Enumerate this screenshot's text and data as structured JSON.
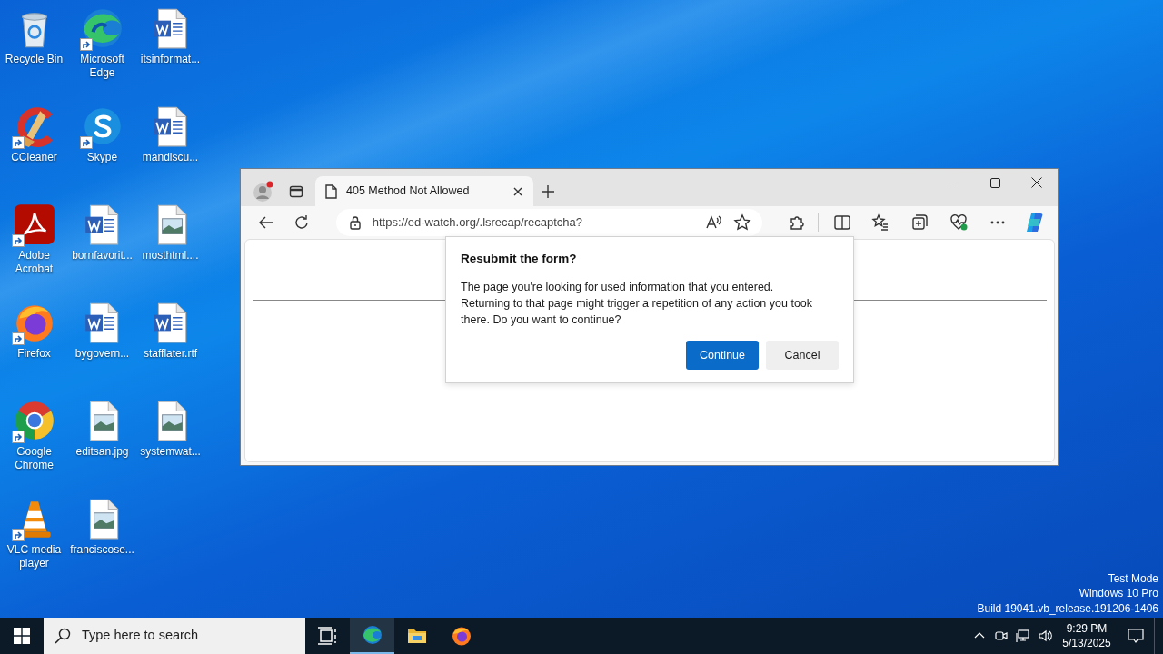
{
  "desktop_icons": [
    {
      "label": "Recycle Bin",
      "kind": "recycle",
      "shortcut": false
    },
    {
      "label": "CCleaner",
      "kind": "ccleaner",
      "shortcut": true
    },
    {
      "label": "Adobe Acrobat",
      "kind": "acrobat",
      "shortcut": true
    },
    {
      "label": "Firefox",
      "kind": "firefox",
      "shortcut": true
    },
    {
      "label": "Google Chrome",
      "kind": "chrome",
      "shortcut": true
    },
    {
      "label": "VLC media player",
      "kind": "vlc",
      "shortcut": true
    },
    {
      "label": "Microsoft Edge",
      "kind": "edge",
      "shortcut": true
    },
    {
      "label": "Skype",
      "kind": "skype",
      "shortcut": true
    },
    {
      "label": "bornfavorit...",
      "kind": "word",
      "shortcut": false
    },
    {
      "label": "bygovern...",
      "kind": "word",
      "shortcut": false
    },
    {
      "label": "editsan.jpg",
      "kind": "image",
      "shortcut": false
    },
    {
      "label": "franciscose...",
      "kind": "image",
      "shortcut": false
    },
    {
      "label": "itsinformat...",
      "kind": "word",
      "shortcut": false
    },
    {
      "label": "mandiscu...",
      "kind": "word",
      "shortcut": false
    },
    {
      "label": "mosthtml....",
      "kind": "image",
      "shortcut": false
    },
    {
      "label": "stafflater.rtf",
      "kind": "word",
      "shortcut": false
    },
    {
      "label": "systemwat...",
      "kind": "image",
      "shortcut": false
    }
  ],
  "browser": {
    "tab": {
      "title": "405 Method Not Allowed"
    },
    "address": {
      "url": "https://ed-watch.org/.lsrecap/recaptcha?"
    },
    "dialog": {
      "title": "Resubmit the form?",
      "message": "The page you're looking for used information that you entered. Returning to that page might trigger a repetition of any action you took there. Do you want to continue?",
      "buttons": [
        {
          "label": "Continue",
          "kind": "primary"
        },
        {
          "label": "Cancel",
          "kind": "secondary"
        }
      ]
    }
  },
  "system_watermark": [
    "Test Mode",
    "Windows 10 Pro",
    "Build 19041.vb_release.191206-1406"
  ],
  "taskbar": {
    "search": {
      "placeholder": "Type here to search"
    },
    "apps": [
      {
        "kind": "taskview",
        "selected": false
      },
      {
        "kind": "edge",
        "selected": true
      },
      {
        "kind": "folder",
        "selected": false
      },
      {
        "kind": "firefox",
        "selected": false
      }
    ],
    "clock": {
      "time": "9:29 PM",
      "date": "5/13/2025"
    }
  }
}
